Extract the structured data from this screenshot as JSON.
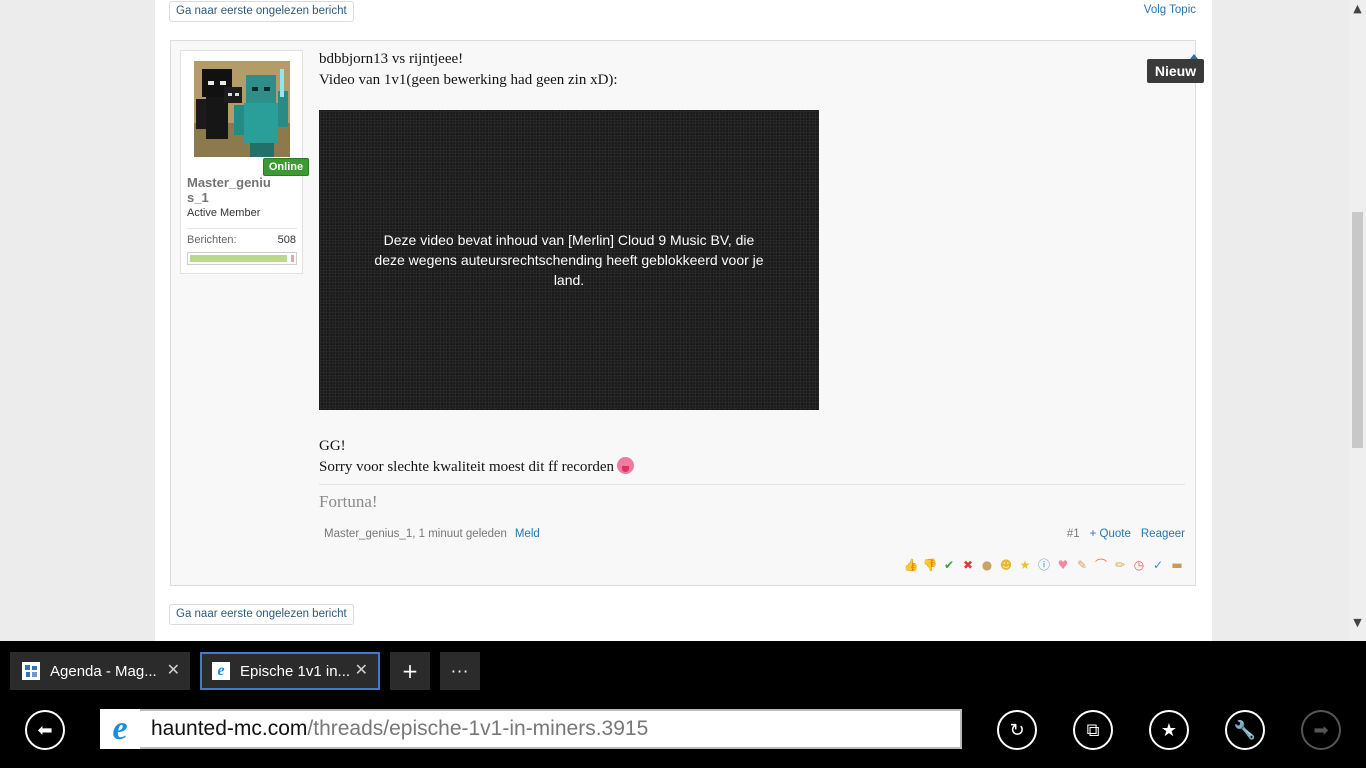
{
  "nav": {
    "first_unread_top": "Ga naar eerste ongelezen bericht",
    "follow_topic": "Volg Topic",
    "first_unread_bottom": "Ga naar eerste ongelezen bericht"
  },
  "post": {
    "new_tag": "Nieuw",
    "user": {
      "online_label": "Online",
      "name": "Master_genius_1",
      "title": "Active Member",
      "stat_label": "Berichten:",
      "stat_value": "508",
      "level_fraction": 0.93
    },
    "lines": [
      "bdbbjorn13 vs rijntjeee!",
      "Video van 1v1(geen bewerking had geen zin xD):"
    ],
    "video_message": "Deze video bevat inhoud van [Merlin] Cloud 9 Music BV, die deze wegens auteursrechtschending heeft geblokkeerd voor je land.",
    "after_lines": [
      "GG!",
      "Sorry voor slechte kwaliteit moest dit ff recorden"
    ],
    "signature": "Fortuna!",
    "meta": {
      "author_time": "Master_genius_1, 1 minuut geleden",
      "report": "Meld",
      "post_number": "#1",
      "quote": "+ Quote",
      "reply": "Reageer"
    },
    "reactions": [
      {
        "icon": "thumbs-up-icon",
        "glyph": "👍"
      },
      {
        "icon": "thumbs-down-icon",
        "glyph": "👎"
      },
      {
        "icon": "checkmark-icon",
        "glyph": "✔",
        "color": "#3aa33a"
      },
      {
        "icon": "cross-icon",
        "glyph": "✖",
        "color": "#d93a3a"
      },
      {
        "icon": "cookie-icon",
        "glyph": "●",
        "color": "#c9a36a"
      },
      {
        "icon": "smile-icon",
        "glyph": "☻",
        "color": "#e8b830"
      },
      {
        "icon": "star-icon",
        "glyph": "★",
        "color": "#e8c230"
      },
      {
        "icon": "info-icon",
        "glyph": "ⓘ",
        "color": "#3a86d9"
      },
      {
        "icon": "heart-icon",
        "glyph": "♥",
        "color": "#f08aa0"
      },
      {
        "icon": "wrench-icon",
        "glyph": "✎",
        "color": "#d9a060"
      },
      {
        "icon": "rainbow-icon",
        "glyph": "⌒",
        "color": "#e87a3a"
      },
      {
        "icon": "pencil-icon",
        "glyph": "✏",
        "color": "#c9b050"
      },
      {
        "icon": "clock-icon",
        "glyph": "◷",
        "color": "#e85a5a"
      },
      {
        "icon": "spellcheck-icon",
        "glyph": "✓",
        "color": "#3a86d9"
      },
      {
        "icon": "box-icon",
        "glyph": "▬",
        "color": "#c99a5a"
      }
    ]
  },
  "browser": {
    "tabs": [
      {
        "title": "Agenda - Mag...",
        "close": "✕",
        "icon": "site-favicon-icon"
      },
      {
        "title": "Epische 1v1 in...",
        "close": "✕",
        "icon": "ie-favicon-icon"
      }
    ],
    "new_tab": "+",
    "more": "···",
    "url_domain": "haunted-mc.com",
    "url_path": "/threads/epische-1v1-in-miners.3915"
  }
}
